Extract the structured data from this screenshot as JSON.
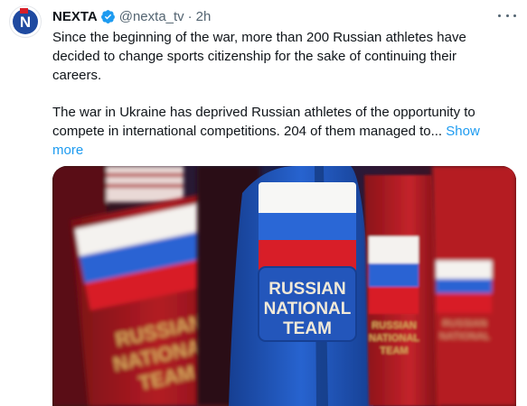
{
  "author": {
    "name": "NEXTA",
    "handle": "@nexta_tv",
    "separator": "·",
    "time": "2h",
    "avatar_letter": "N",
    "avatar_color": "#1f4aa0",
    "verified_color": "#1d9bf0"
  },
  "tweet": {
    "paragraph1": "Since the beginning of the war, more than 200 Russian athletes have decided to change sports citizenship for the sake of continuing their careers.",
    "paragraph2": "The war in Ukraine has deprived Russian athletes of the opportunity to compete in international competitions. 204 of them managed to...",
    "show_more": "Show more"
  },
  "media": {
    "badge_line1": "RUSSIAN",
    "badge_line2": "NATIONAL",
    "badge_line3": "TEAM",
    "flag_colors": [
      "#ffffff",
      "#1f5fd0",
      "#d81e28"
    ],
    "jacket_colors": {
      "blue": "#1f5bc4",
      "red": "#b51a22",
      "dark_red": "#6d0f15"
    }
  },
  "icons": {
    "more_menu": "more-horizontal-icon",
    "verified": "verified-badge-icon"
  }
}
